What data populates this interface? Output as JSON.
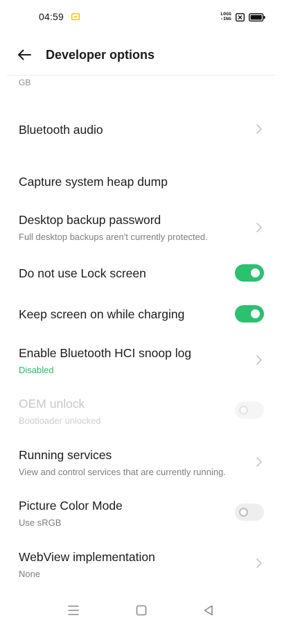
{
  "status_bar": {
    "time": "04:59",
    "logging_line1": "LOGG",
    "logging_line2": "-ING"
  },
  "header": {
    "title": "Developer options"
  },
  "fragment_above": "GB",
  "settings": [
    {
      "title": "Bluetooth audio",
      "subtitle": "",
      "control": "chevron"
    },
    {
      "title": "Capture system heap dump",
      "subtitle": "",
      "control": "none"
    },
    {
      "title": "Desktop backup password",
      "subtitle": "Full desktop backups aren't currently protected.",
      "control": "chevron"
    },
    {
      "title": "Do not use Lock screen",
      "subtitle": "",
      "control": "toggle",
      "checked": true
    },
    {
      "title": "Keep screen on while charging",
      "subtitle": "",
      "control": "toggle",
      "checked": true
    },
    {
      "title": "Enable Bluetooth HCI snoop log",
      "subtitle": "Disabled",
      "control": "chevron"
    },
    {
      "title": "OEM unlock",
      "subtitle": "Bootloader unlocked",
      "control": "toggle",
      "checked": false,
      "enabled": false
    },
    {
      "title": "Running services",
      "subtitle": "View and control services that are currently running.",
      "control": "chevron"
    },
    {
      "title": "Picture Color Mode",
      "subtitle": "Use sRGB",
      "control": "toggle",
      "checked": false
    },
    {
      "title": "WebView implementation",
      "subtitle": "None",
      "control": "chevron"
    }
  ],
  "colors": {
    "accent": "#2bc16f",
    "accent_text": "#26b96b"
  },
  "nav_bar": {
    "icons": [
      "menu-icon",
      "home-icon",
      "back-triangle-icon"
    ]
  }
}
